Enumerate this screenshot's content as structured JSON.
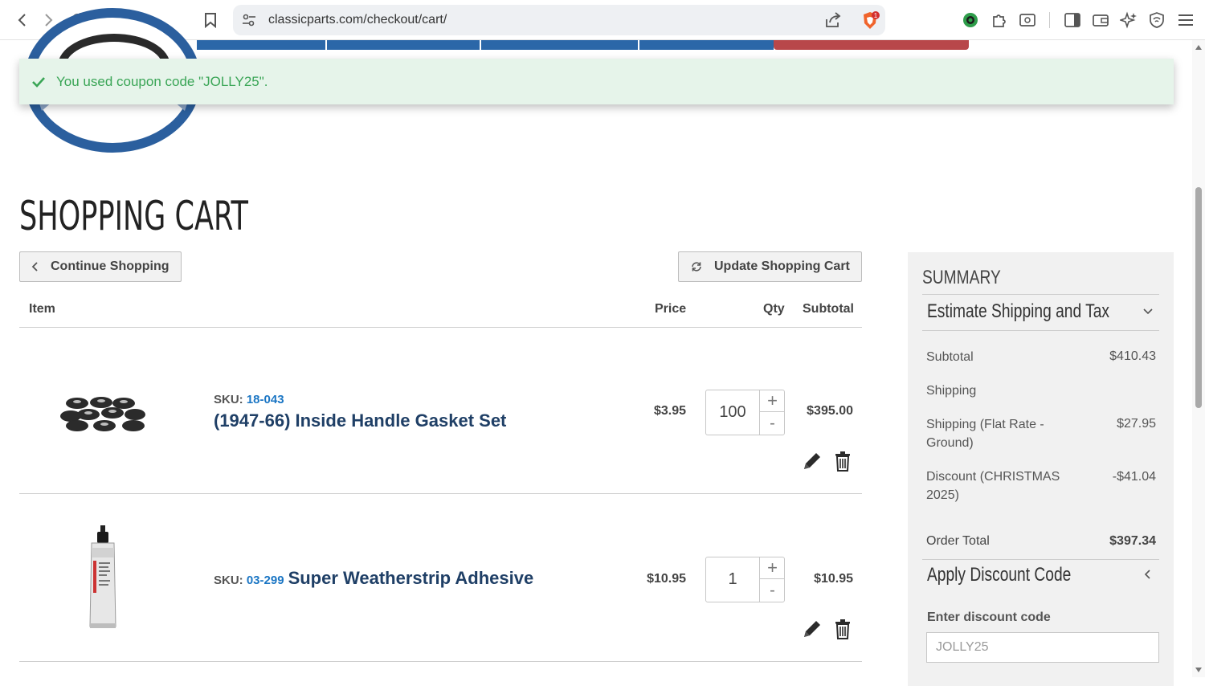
{
  "browser": {
    "url": "classicparts.com/checkout/cart/",
    "brave_badge": "1"
  },
  "message": {
    "text": "You used coupon code \"JOLLY25\"."
  },
  "page": {
    "title": "SHOPPING CART"
  },
  "toolbar": {
    "continue_label": "Continue Shopping",
    "update_label": "Update Shopping Cart"
  },
  "table": {
    "headers": {
      "item": "Item",
      "price": "Price",
      "qty": "Qty",
      "subtotal": "Subtotal"
    }
  },
  "items": [
    {
      "sku_label": "SKU:",
      "sku": "18-043",
      "name": "(1947-66) Inside Handle Gasket Set",
      "price": "$3.95",
      "qty": "100",
      "subtotal": "$395.00"
    },
    {
      "sku_label": "SKU:",
      "sku": "03-299",
      "name": "Super Weatherstrip Adhesive",
      "price": "$10.95",
      "qty": "1",
      "subtotal": "$10.95"
    }
  ],
  "qty_controls": {
    "plus": "+",
    "minus": "-"
  },
  "summary": {
    "title": "SUMMARY",
    "estimate_section": "Estimate Shipping and Tax",
    "rows": [
      {
        "label": "Subtotal",
        "value": "$410.43"
      },
      {
        "label": "Shipping",
        "value": ""
      },
      {
        "label": "Shipping (Flat Rate - Ground)",
        "value": "$27.95"
      },
      {
        "label": "Discount (CHRISTMAS 2025)",
        "value": "-$41.04"
      }
    ],
    "order_total_label": "Order Total",
    "order_total_value": "$397.34",
    "discount_section": "Apply Discount Code",
    "discount_field_label": "Enter discount code",
    "discount_field_value": "JOLLY25"
  },
  "colors": {
    "accent_blue": "#2b67a8",
    "accent_red": "#b8474a",
    "success_green": "#3aa556",
    "product_title": "#1f3f66",
    "sku_link": "#1b76c4"
  }
}
